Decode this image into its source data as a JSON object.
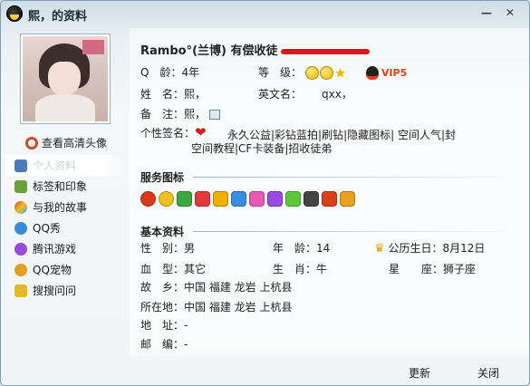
{
  "window": {
    "title": "熙，的资料",
    "minimize_symbol": "—",
    "close_symbol": "✕"
  },
  "left": {
    "view_hd_label": "查看高清头像",
    "menu": [
      {
        "label": "个人资料",
        "icon": "profile-icon",
        "color": "#4a7ab8",
        "active": true
      },
      {
        "label": "标签和印象",
        "icon": "tag-icon",
        "color": "#6aa33a"
      },
      {
        "label": "与我的故事",
        "icon": "rainbow-icon",
        "color": "#e86a2a"
      },
      {
        "label": "QQ秀",
        "icon": "qqshow-icon",
        "color": "#3a8ad8"
      },
      {
        "label": "腾讯游戏",
        "icon": "game-icon",
        "color": "#9a4ad8"
      },
      {
        "label": "QQ宠物",
        "icon": "pet-icon",
        "color": "#e0a020"
      },
      {
        "label": "搜搜问问",
        "icon": "question-icon",
        "color": "#e8b820"
      }
    ]
  },
  "profile": {
    "name": "Rambo°(兰博) 有偿收徒",
    "age_label": "Q　龄：",
    "age_value": "4年",
    "level_label": "等　级：",
    "vip_label": "VIP5",
    "surname_label": "姓　名：",
    "surname_value": "熙，",
    "english_label": "英文名：",
    "english_value": "qxx，",
    "remark_label": "备　注：",
    "remark_value": "熙，",
    "signature_label": "个性签名：",
    "signature_line1": "永久公益|彩钻蓝拍|刷钻|隐藏图标| 空间人气|封",
    "signature_line2": "空间教程|CF卡装备|招收徒弟"
  },
  "services": {
    "title": "服务图标",
    "icons": [
      {
        "name": "qq-penguin-icon",
        "color": "#d83a1a"
      },
      {
        "name": "qzone-icon",
        "color": "#f0c020"
      },
      {
        "name": "green-diamond-icon",
        "color": "#3aa83a"
      },
      {
        "name": "red-diamond-icon",
        "color": "#e03a3a"
      },
      {
        "name": "yellow-diamond-icon",
        "color": "#f0b000"
      },
      {
        "name": "blue-diamond-icon",
        "color": "#3a8ae0"
      },
      {
        "name": "pink-diamond-icon",
        "color": "#e85ab0"
      },
      {
        "name": "purple-diamond-icon",
        "color": "#9a4ae0"
      },
      {
        "name": "lime-diamond-icon",
        "color": "#5ac83a"
      },
      {
        "name": "black-diamond-icon",
        "color": "#444444"
      },
      {
        "name": "game-badge-icon",
        "color": "#d8401a"
      },
      {
        "name": "book-icon",
        "color": "#e8a020"
      }
    ]
  },
  "basic": {
    "title": "基本资料",
    "gender_label": "性　别：",
    "gender_value": "男",
    "age_label": "年　龄：",
    "age_value": "14",
    "birthday_label": "公历生日：",
    "birthday_value": "8月12日",
    "blood_label": "血　型：",
    "blood_value": "其它",
    "zodiac_label": "生　肖：",
    "zodiac_value": "牛",
    "constellation_label": "星　　座：",
    "constellation_value": "狮子座",
    "hometown_label": "故　乡：",
    "hometown_value": "中国 福建 龙岩 上杭县",
    "location_label": "所在地：",
    "location_value": "中国 福建 龙岩 上杭县",
    "address_label": "地　址：",
    "address_value": "-",
    "zip_label": "邮　编：",
    "zip_value": "-"
  },
  "footer": {
    "refresh_label": "更新",
    "close_label": "关闭"
  }
}
